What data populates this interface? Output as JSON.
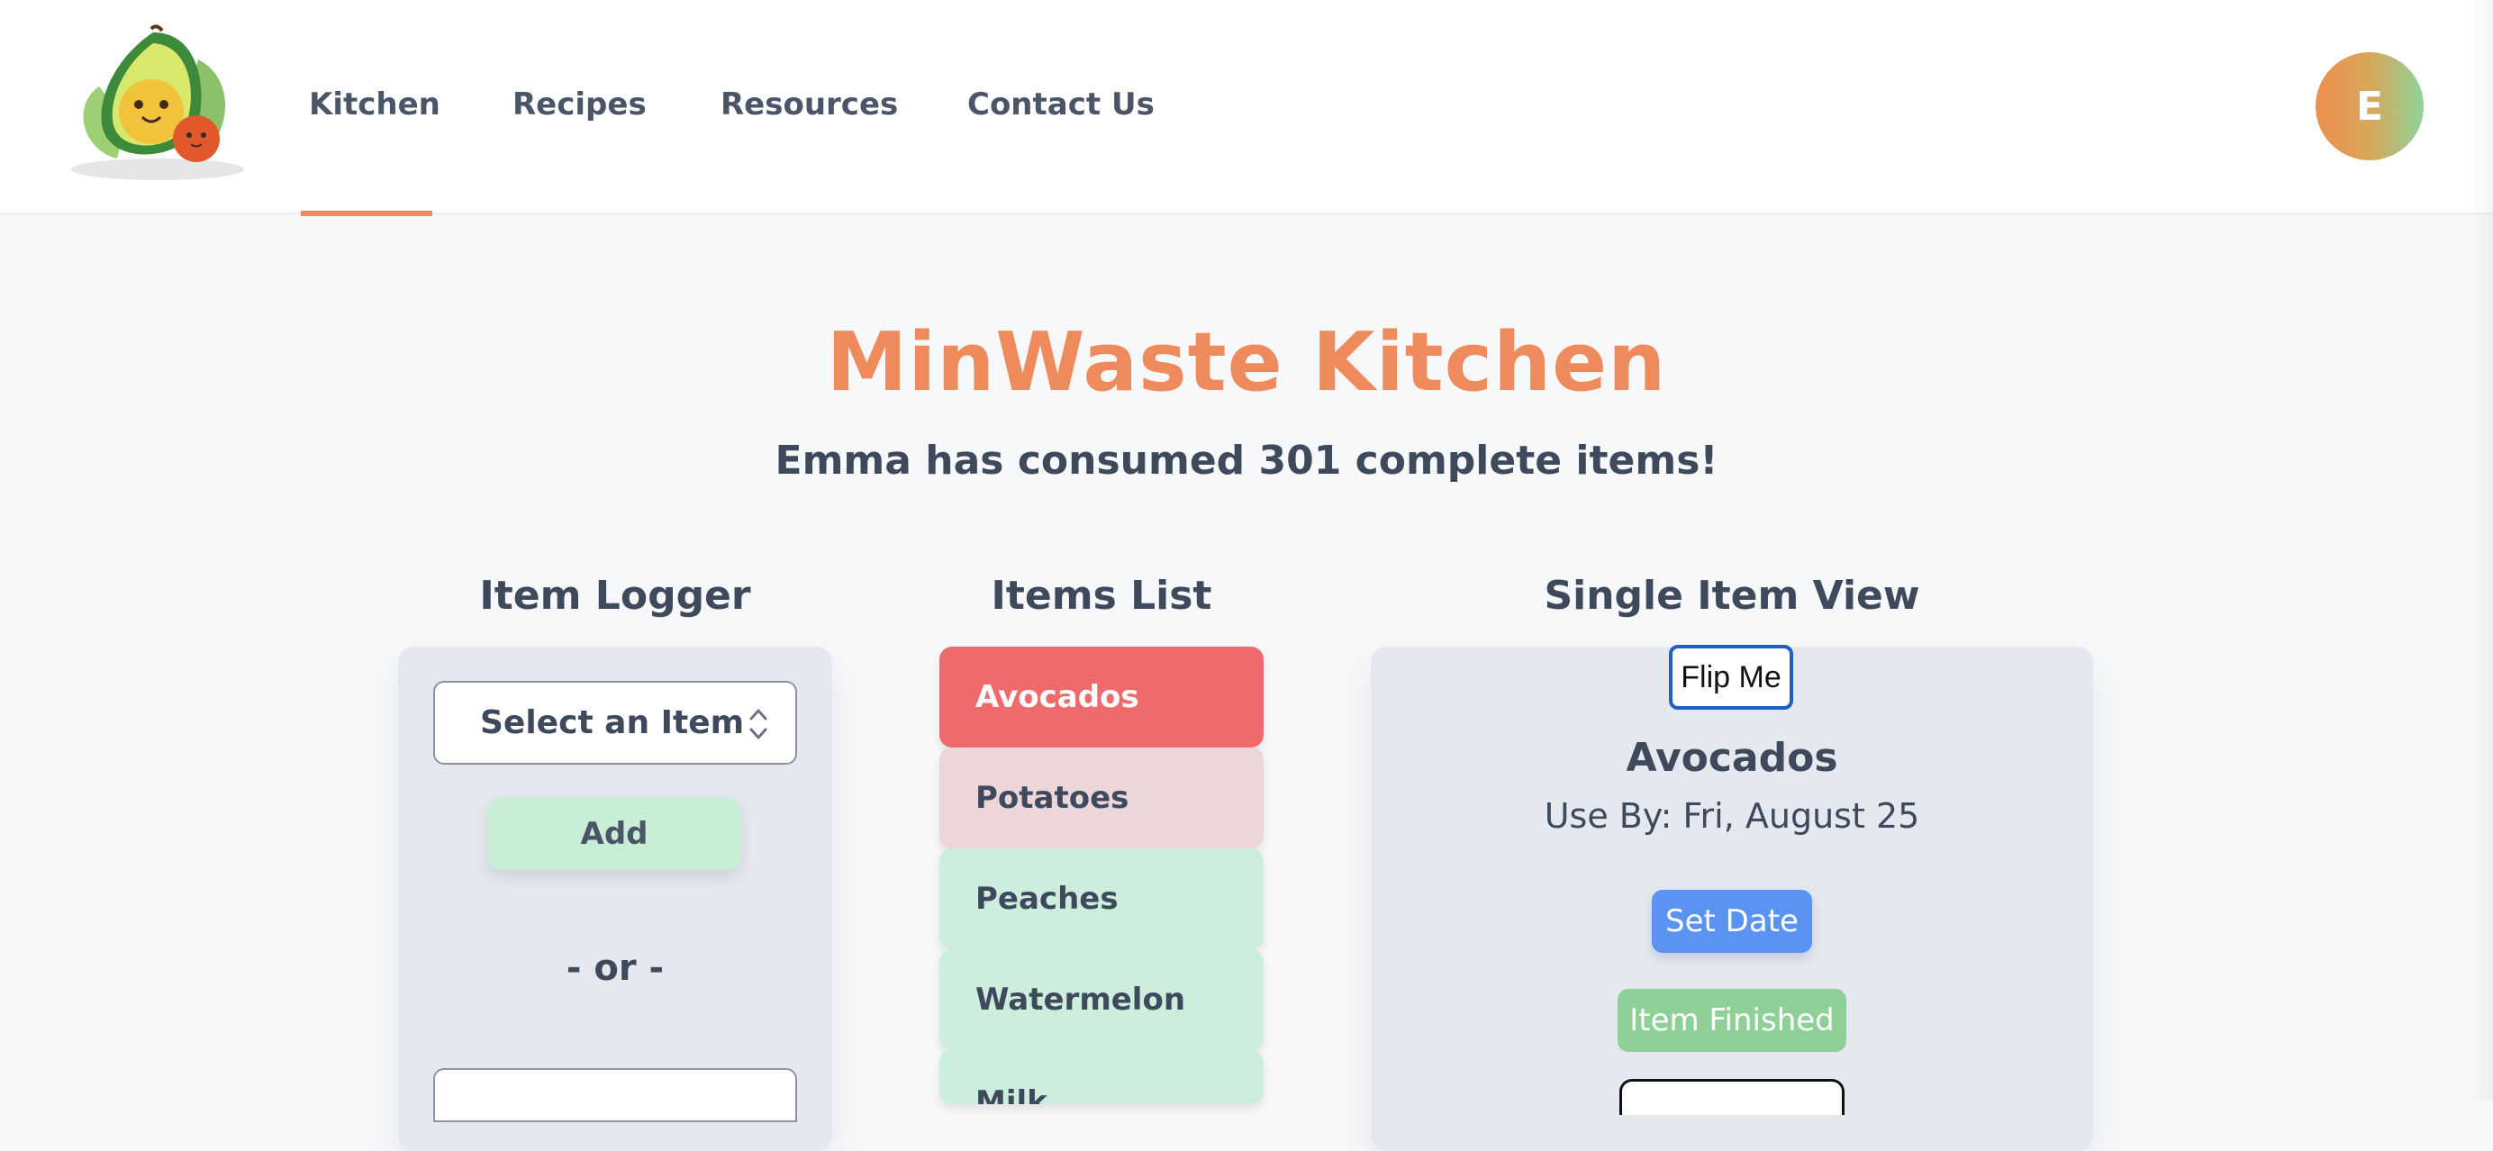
{
  "nav": {
    "items": [
      "Kitchen",
      "Recipes",
      "Resources",
      "Contact Us"
    ],
    "active": "Kitchen"
  },
  "user": {
    "avatar_initial": "E"
  },
  "page": {
    "title": "MinWaste Kitchen",
    "subtitle": "Emma has consumed 301 complete items!"
  },
  "logger": {
    "heading": "Item Logger",
    "select_value": "Select an Item",
    "add_label": "Add",
    "or_label": "- or -"
  },
  "items_list": {
    "heading": "Items List",
    "items": [
      {
        "label": "Avocados",
        "status": "active"
      },
      {
        "label": "Potatoes",
        "status": "warning"
      },
      {
        "label": "Peaches",
        "status": "ok"
      },
      {
        "label": "Watermelon",
        "status": "ok"
      },
      {
        "label": "Milk",
        "status": "ok"
      }
    ]
  },
  "single_item": {
    "heading": "Single Item View",
    "flip_label": "Flip Me",
    "name": "Avocados",
    "use_by": "Use By: Fri, August 25",
    "set_date_label": "Set Date",
    "finished_label": "Item Finished"
  },
  "colors": {
    "accent": "#ee8a5c",
    "active_item": "#ef6b6b",
    "warning_item": "#ecd6da",
    "ok_item": "#cdeedd",
    "set_date": "#5b93f2",
    "finished": "#8fcf98"
  },
  "icons": {
    "logo": "avocado-logo",
    "select": "chevron-up-down-icon"
  }
}
